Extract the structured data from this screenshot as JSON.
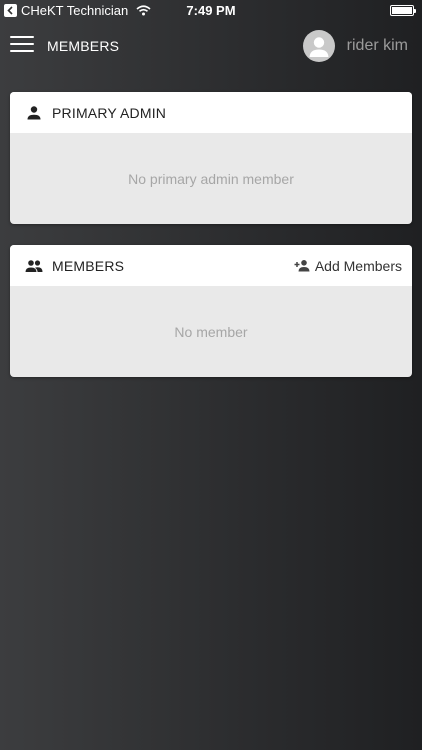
{
  "status_bar": {
    "app_back_label": "CHeKT Technician",
    "time": "7:49 PM",
    "battery_level": 1.0
  },
  "nav": {
    "title": "MEMBERS",
    "user_name": "rider kim"
  },
  "primary_admin": {
    "title": "PRIMARY ADMIN",
    "empty_text": "No primary admin member"
  },
  "members": {
    "title": "MEMBERS",
    "add_label": "Add Members",
    "empty_text": "No member"
  },
  "icons": {
    "menu": "hamburger-menu-icon",
    "avatar": "person-icon",
    "primary_admin": "person-icon",
    "members": "group-icon",
    "add_members": "person-add-icon"
  },
  "colors": {
    "card_header": "#ffffff",
    "card_body": "#e9e9e9",
    "empty_text": "#a6a6a6",
    "user_name": "#9b9b9b"
  }
}
